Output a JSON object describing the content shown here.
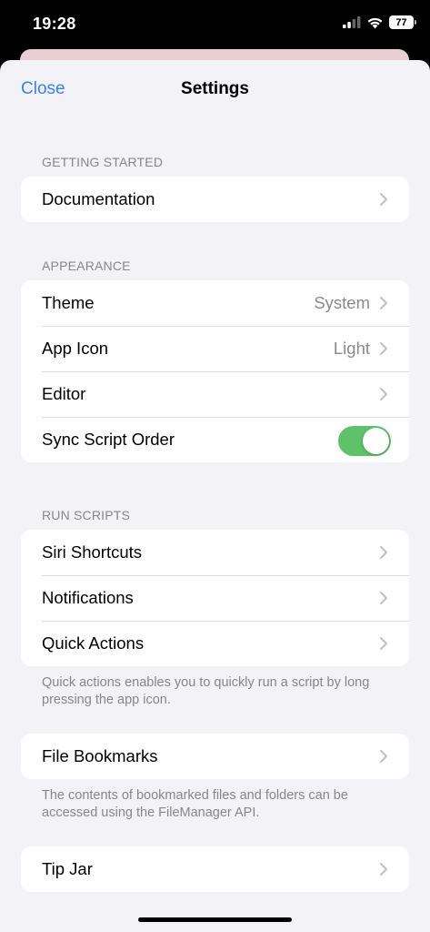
{
  "status_bar": {
    "time": "19:28",
    "battery": "77"
  },
  "nav": {
    "close_label": "Close",
    "title": "Settings"
  },
  "sections": {
    "getting_started": {
      "header": "GETTING STARTED",
      "items": [
        {
          "label": "Documentation"
        }
      ]
    },
    "appearance": {
      "header": "APPEARANCE",
      "items": [
        {
          "label": "Theme",
          "value": "System"
        },
        {
          "label": "App Icon",
          "value": "Light"
        },
        {
          "label": "Editor"
        },
        {
          "label": "Sync Script Order",
          "toggle_on": true
        }
      ]
    },
    "run_scripts": {
      "header": "RUN SCRIPTS",
      "items": [
        {
          "label": "Siri Shortcuts"
        },
        {
          "label": "Notifications"
        },
        {
          "label": "Quick Actions"
        }
      ],
      "footer": "Quick actions enables you to quickly run a script by long pressing the app icon."
    },
    "bookmarks": {
      "items": [
        {
          "label": "File Bookmarks"
        }
      ],
      "footer": "The contents of bookmarked files and folders can be accessed using the FileManager API."
    },
    "tip_jar": {
      "items": [
        {
          "label": "Tip Jar"
        }
      ]
    }
  },
  "colors": {
    "accent": "#3a80f5",
    "toggle_on": "#5ec26a",
    "background": "#f2f2f7"
  }
}
